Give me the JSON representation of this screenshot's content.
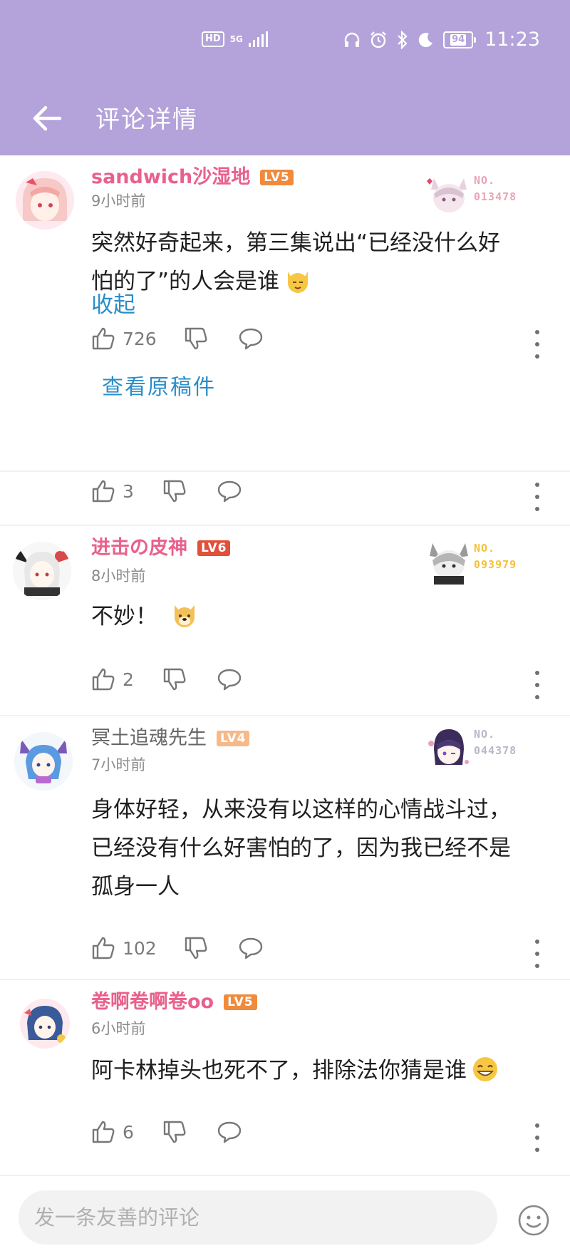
{
  "status_bar": {
    "hd": "HD",
    "network": "5G",
    "battery": "94",
    "time": "11:23"
  },
  "header": {
    "title": "评论详情",
    "back_icon": "arrow-left-icon"
  },
  "colors": {
    "header_bg": "#b3a3da",
    "link": "#2a8dc7",
    "username_pink": "#e8618c",
    "username_gray": "#666666",
    "lv5": "#f08a3c",
    "lv6": "#e0503a",
    "lv4": "#f6b98a"
  },
  "comments": [
    {
      "username": "sandwich沙湿地",
      "level": "LV5",
      "time": "9小时前",
      "text_line1": "突然好奇起来，第三集说出“已经没什么好",
      "text_line2": "怕的了”的人会是谁",
      "emoji": "cat-face-emoji",
      "collapse": "收起",
      "likes": "726",
      "view_original": "查看原稿件",
      "fan_no_label": "NO.",
      "fan_no": "013478"
    },
    {
      "likes": "3"
    },
    {
      "username": "进击の皮神",
      "level": "LV6",
      "time": "8小时前",
      "text": "不妙！",
      "emoji": "doge-face-emoji",
      "likes": "2",
      "fan_no_label": "NO.",
      "fan_no": "093979"
    },
    {
      "username": "冥土追魂先生",
      "level": "LV4",
      "time": "7小时前",
      "text_line1": "身体好轻，从来没有以这样的心情战斗过，",
      "text_line2": "已经没有什么好害怕的了，因为我已经不是",
      "text_line3": "孤身一人",
      "likes": "102",
      "fan_no_label": "NO.",
      "fan_no": "044378"
    },
    {
      "username": "卷啊卷啊卷oo",
      "level": "LV5",
      "time": "6小时前",
      "text": "阿卡林掉头也死不了，排除法你猜是谁",
      "emoji": "grin-face-emoji",
      "likes": "6"
    }
  ],
  "bottom": {
    "placeholder": "发一条友善的评论",
    "emoji_button_icon": "smiley-icon"
  }
}
